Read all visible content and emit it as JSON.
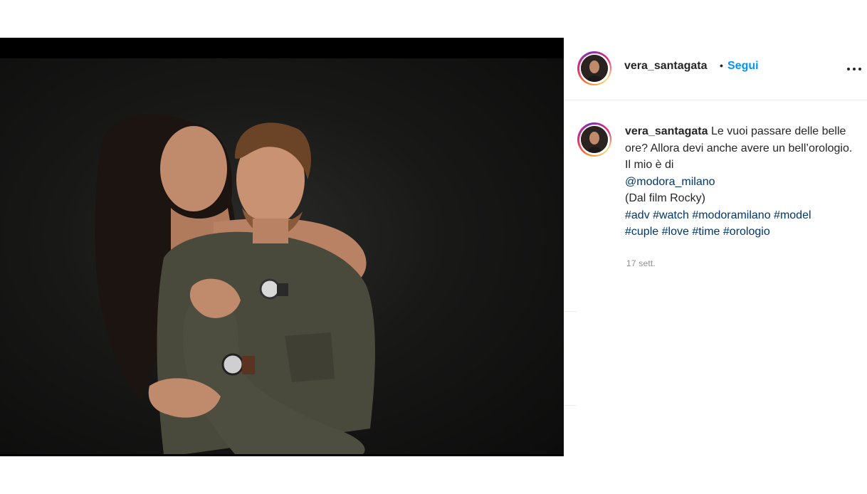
{
  "post": {
    "image_alt": "",
    "username": "vera_santagata",
    "dot": "•",
    "follow_label": "Segui",
    "more_icon": "more-horizontal-icon"
  },
  "caption": {
    "username": "vera_santagata",
    "text_line1": "Le vuoi passare delle belle ore? Allora devi anche avere un bell’orologio. Il mio è di",
    "mention": "@modora_milano",
    "text_line2": "(Dal film Rocky)",
    "hashtags": [
      "#adv",
      "#watch",
      "#modoramilano",
      "#model",
      "#cuple",
      "#love",
      "#time",
      "#orologio"
    ],
    "time": "17 sett."
  },
  "colors": {
    "follow": "#0095f6",
    "link": "#00376b",
    "muted": "#8e8e8e"
  }
}
